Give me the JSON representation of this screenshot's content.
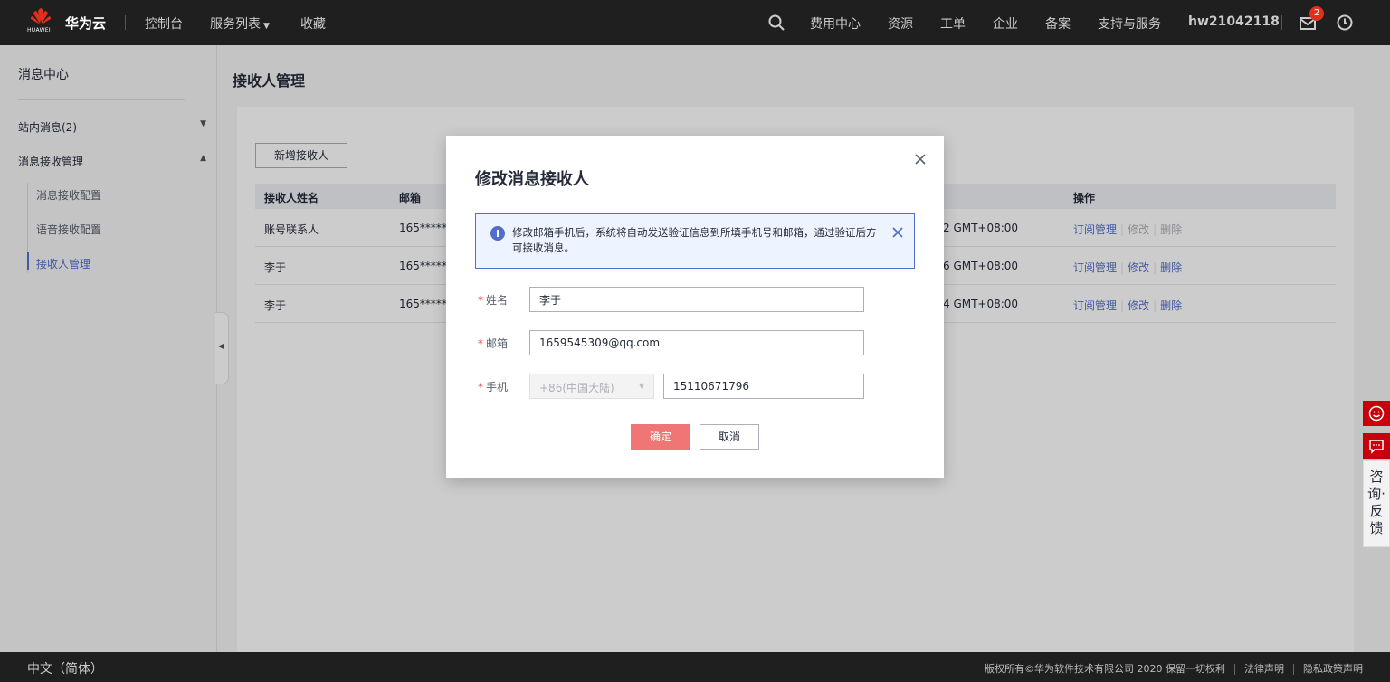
{
  "header": {
    "logo_text": "HUAWEI",
    "brand": "华为云",
    "nav_left": [
      "控制台",
      "服务列表",
      "收藏"
    ],
    "nav_right": [
      "费用中心",
      "资源",
      "工单",
      "企业",
      "备案",
      "支持与服务"
    ],
    "username": "hw21042118",
    "message_badge": "2",
    "icons": [
      "search-icon",
      "mail-icon",
      "clock-icon"
    ]
  },
  "sidebar": {
    "title": "消息中心",
    "groups": [
      {
        "label": "站内消息(2)",
        "expanded": false
      },
      {
        "label": "消息接收管理",
        "expanded": true
      }
    ],
    "sub_items": [
      {
        "label": "消息接收配置",
        "active": false
      },
      {
        "label": "语音接收配置",
        "active": false
      },
      {
        "label": "接收人管理",
        "active": true
      }
    ]
  },
  "main": {
    "page_title": "接收人管理",
    "add_button": "新增接收人",
    "columns": [
      "接收人姓名",
      "邮箱",
      "",
      "操作"
    ],
    "rows": [
      {
        "name": "账号联系人",
        "email": "165*****0",
        "time": "2 GMT+08:00",
        "op_subscribe": "订阅管理",
        "op_edit": "修改",
        "op_delete": "删除",
        "ops_enabled": false
      },
      {
        "name": "李于",
        "email": "165*****0",
        "time": "6 GMT+08:00",
        "op_subscribe": "订阅管理",
        "op_edit": "修改",
        "op_delete": "删除",
        "ops_enabled": true
      },
      {
        "name": "李于",
        "email": "165*****0",
        "time": "4 GMT+08:00",
        "op_subscribe": "订阅管理",
        "op_edit": "修改",
        "op_delete": "删除",
        "ops_enabled": true
      }
    ]
  },
  "dialog": {
    "title": "修改消息接收人",
    "alert": "修改邮箱手机后，系统将自动发送验证信息到所填手机号和邮箱，通过验证后方可接收消息。",
    "fields": {
      "name_label": "姓名",
      "name_value": "李于",
      "email_label": "邮箱",
      "email_value": "1659545309@qq.com",
      "phone_label": "手机",
      "phone_region": "+86(中国大陆)",
      "phone_value": "15110671796"
    },
    "required_mark": "*",
    "confirm": "确定",
    "cancel": "取消"
  },
  "float_panel": {
    "text": "咨询·反馈"
  },
  "footer": {
    "language": "中文（简体）",
    "copyright": "版权所有©华为软件技术有限公司 2020 保留一切权利",
    "legal": "法律声明",
    "privacy": "隐私政策声明"
  },
  "colors": {
    "topbar": "#1f1f1f",
    "accent_blue": "#526ecc",
    "brand_red": "#c7000b",
    "confirm_button": "#f07676"
  }
}
